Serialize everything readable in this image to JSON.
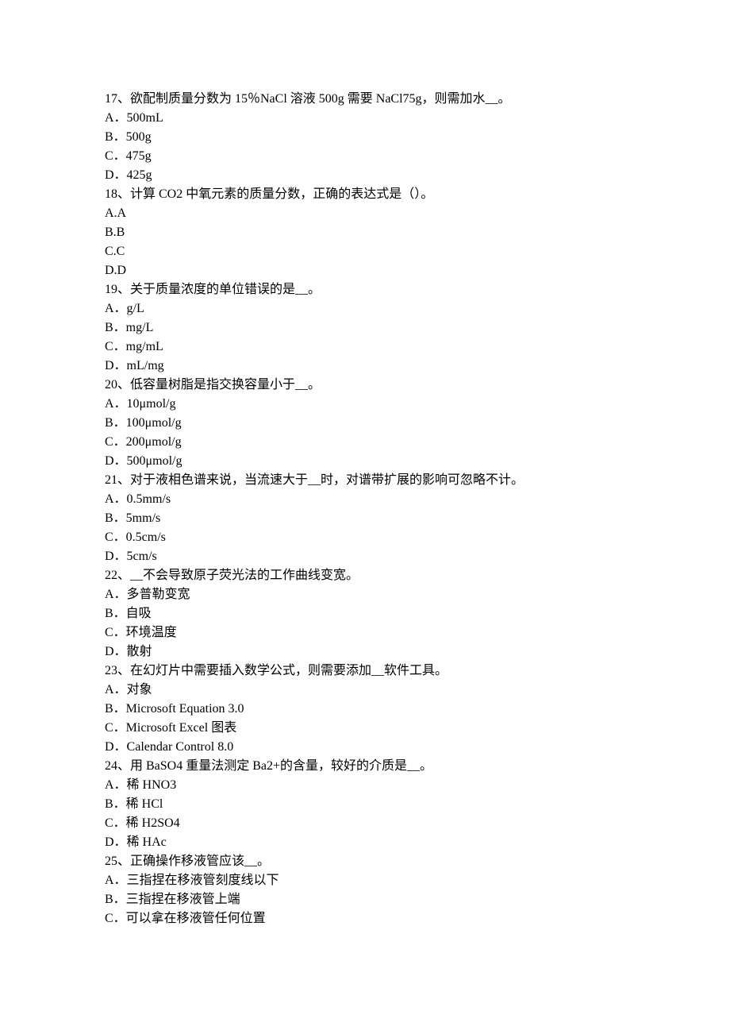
{
  "questions": [
    {
      "number": "17",
      "text": "17、欲配制质量分数为 15％NaCl 溶液 500g 需要 NaCl75g，则需加水__。",
      "options": [
        "A．500mL",
        "B．500g",
        "C．475g",
        "D．425g"
      ]
    },
    {
      "number": "18",
      "text": "18、计算 CO2 中氧元素的质量分数，正确的表达式是（）。",
      "options": [
        "A.A",
        "B.B",
        "C.C",
        "D.D"
      ]
    },
    {
      "number": "19",
      "text": "19、关于质量浓度的单位错误的是__。",
      "options": [
        "A．g/L",
        "B．mg/L",
        "C．mg/mL",
        "D．mL/mg"
      ]
    },
    {
      "number": "20",
      "text": "20、低容量树脂是指交换容量小于__。",
      "options": [
        "A．10μmol/g",
        "B．100μmol/g",
        "C．200μmol/g",
        "D．500μmol/g"
      ]
    },
    {
      "number": "21",
      "text": "21、对于液相色谱来说，当流速大于__时，对谱带扩展的影响可忽略不计。",
      "options": [
        "A．0.5mm/s",
        "B．5mm/s",
        "C．0.5cm/s",
        "D．5cm/s"
      ]
    },
    {
      "number": "22",
      "text": "22、__不会导致原子荧光法的工作曲线变宽。",
      "options": [
        "A．多普勒变宽",
        "B．自吸",
        "C．环境温度",
        "D．散射"
      ]
    },
    {
      "number": "23",
      "text": "23、在幻灯片中需要插入数学公式，则需要添加__软件工具。",
      "options": [
        "A．对象",
        "B．Microsoft Equation 3.0",
        "C．Microsoft Excel 图表",
        "D．Calendar Control 8.0"
      ]
    },
    {
      "number": "24",
      "text": "24、用 BaSO4 重量法测定 Ba2+的含量，较好的介质是__。",
      "options": [
        "A．稀 HNO3",
        "B．稀 HCl",
        "C．稀 H2SO4",
        "D．稀 HAc"
      ]
    },
    {
      "number": "25",
      "text": "25、正确操作移液管应该__。",
      "options": [
        "A．三指捏在移液管刻度线以下",
        "B．三指捏在移液管上端",
        "C．可以拿在移液管任何位置"
      ]
    }
  ]
}
